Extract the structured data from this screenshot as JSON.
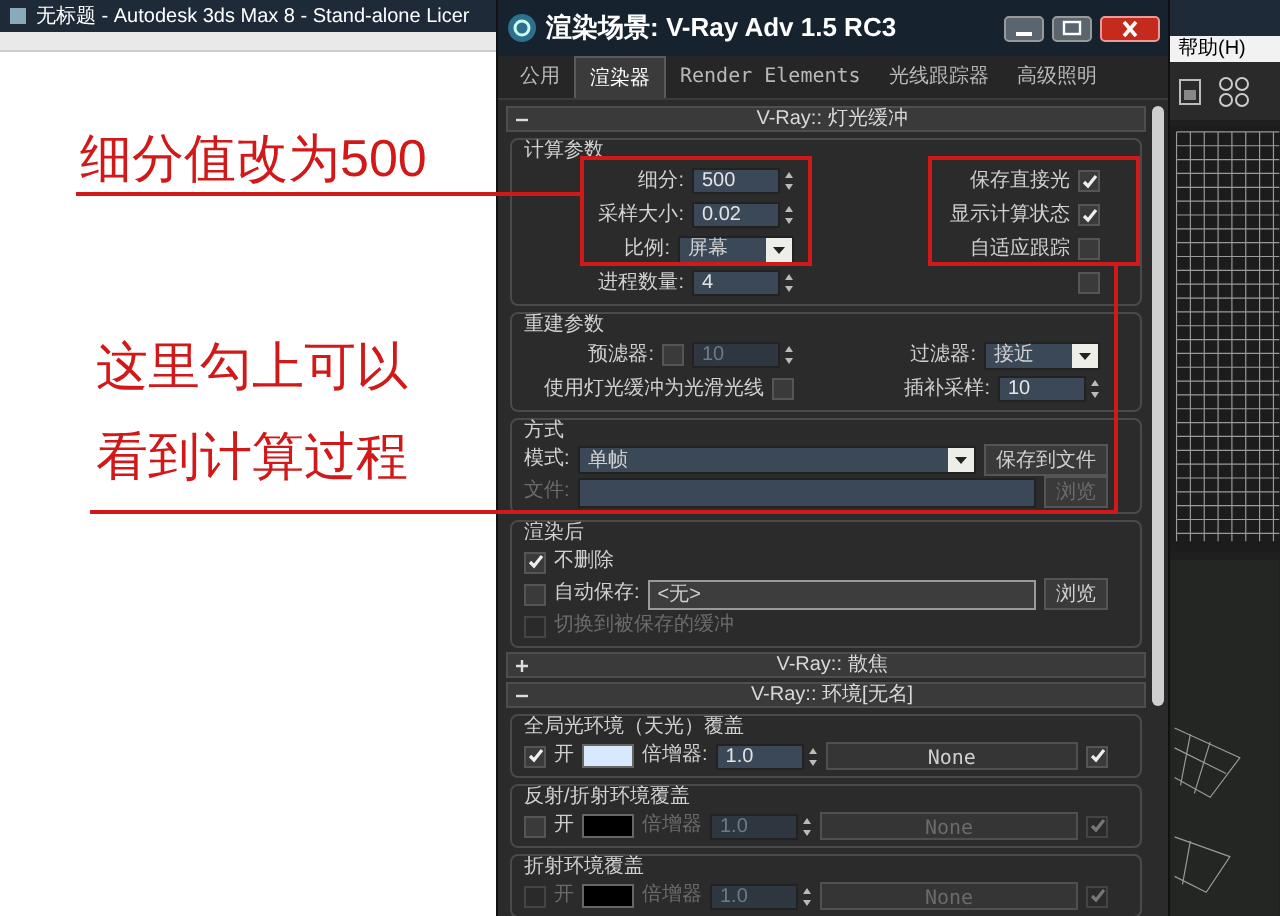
{
  "background_window": {
    "title": "无标题 - Autodesk 3ds Max 8 - Stand-alone Licer",
    "help_menu": "帮助(H)"
  },
  "dialog": {
    "title": "渲染场景: V-Ray Adv 1.5 RC3",
    "tabs": [
      {
        "label": "公用",
        "selected": false
      },
      {
        "label": "渲染器",
        "selected": true
      },
      {
        "label": "Render Elements",
        "selected": false
      },
      {
        "label": "光线跟踪器",
        "selected": false
      },
      {
        "label": "高级照明",
        "selected": false
      }
    ],
    "rollouts": [
      {
        "title": "V-Ray:: 灯光缓冲",
        "expanded": true,
        "groups": [
          {
            "title": "计算参数",
            "rows": [
              {
                "kind": "split",
                "left": [
                  {
                    "kind": "text",
                    "text": "细分:",
                    "disabled": false
                  },
                  {
                    "kind": "spinner",
                    "value": "500",
                    "disabled": false
                  }
                ],
                "right": [
                  {
                    "kind": "text",
                    "text": "保存直接光",
                    "disabled": false
                  },
                  {
                    "kind": "checkbox",
                    "checked": true,
                    "disabled": false
                  }
                ]
              },
              {
                "kind": "split",
                "left": [
                  {
                    "kind": "text",
                    "text": "采样大小:",
                    "disabled": false
                  },
                  {
                    "kind": "spinner",
                    "value": "0.02",
                    "disabled": false
                  }
                ],
                "right": [
                  {
                    "kind": "text",
                    "text": "显示计算状态",
                    "disabled": false
                  },
                  {
                    "kind": "checkbox",
                    "checked": true,
                    "disabled": false
                  }
                ]
              },
              {
                "kind": "split",
                "left": [
                  {
                    "kind": "text",
                    "text": "比例:",
                    "disabled": false
                  },
                  {
                    "kind": "dropdown",
                    "value": "屏幕",
                    "disabled": false
                  }
                ],
                "right": [
                  {
                    "kind": "text",
                    "text": "自适应跟踪",
                    "disabled": false
                  },
                  {
                    "kind": "checkbox",
                    "checked": false,
                    "disabled": false
                  }
                ]
              },
              {
                "kind": "split",
                "left": [
                  {
                    "kind": "text",
                    "text": "进程数量:",
                    "disabled": false
                  },
                  {
                    "kind": "spinner",
                    "value": "4",
                    "disabled": false
                  }
                ],
                "right": [
                  {
                    "kind": "checkbox",
                    "checked": false,
                    "disabled": false
                  }
                ]
              }
            ]
          },
          {
            "title": "重建参数",
            "rows": [
              {
                "kind": "split",
                "left": [
                  {
                    "kind": "text",
                    "text": "预滤器:",
                    "disabled": false
                  },
                  {
                    "kind": "checkbox",
                    "checked": false,
                    "disabled": false
                  },
                  {
                    "kind": "spinner",
                    "value": "10",
                    "disabled": true
                  }
                ],
                "right": [
                  {
                    "kind": "text",
                    "text": "过滤器:",
                    "disabled": false
                  },
                  {
                    "kind": "dropdown",
                    "value": "接近",
                    "disabled": false
                  }
                ]
              },
              {
                "kind": "split",
                "left": [
                  {
                    "kind": "text",
                    "text": "使用灯光缓冲为光滑光线",
                    "disabled": false
                  },
                  {
                    "kind": "checkbox",
                    "checked": false,
                    "disabled": false
                  }
                ],
                "right": [
                  {
                    "kind": "text",
                    "text": "插补采样:",
                    "disabled": false
                  },
                  {
                    "kind": "spinner",
                    "value": "10",
                    "disabled": false
                  }
                ]
              }
            ]
          },
          {
            "title": "方式",
            "rows": [
              {
                "kind": "fill",
                "items": [
                  {
                    "kind": "text",
                    "text": "模式:",
                    "disabled": false
                  },
                  {
                    "kind": "dropdown",
                    "value": "单帧",
                    "disabled": false
                  },
                  {
                    "kind": "button",
                    "label": "保存到文件",
                    "disabled": false
                  }
                ]
              },
              {
                "kind": "fill",
                "items": [
                  {
                    "kind": "text",
                    "text": "文件:",
                    "disabled": true
                  },
                  {
                    "kind": "field",
                    "value": "",
                    "disabled": false
                  },
                  {
                    "kind": "button",
                    "label": "浏览",
                    "disabled": true
                  }
                ]
              }
            ]
          },
          {
            "title": "渲染后",
            "rows": [
              {
                "kind": "fill",
                "items": [
                  {
                    "kind": "checkbox",
                    "checked": true,
                    "disabled": false
                  },
                  {
                    "kind": "text",
                    "text": "不删除",
                    "disabled": false
                  }
                ]
              },
              {
                "kind": "fill",
                "items": [
                  {
                    "kind": "checkbox",
                    "checked": false,
                    "disabled": false
                  },
                  {
                    "kind": "text",
                    "text": "自动保存:",
                    "disabled": false
                  },
                  {
                    "kind": "field",
                    "value": "<无>",
                    "disabled": false
                  },
                  {
                    "kind": "button",
                    "label": "浏览",
                    "disabled": false
                  }
                ]
              },
              {
                "kind": "fill",
                "items": [
                  {
                    "kind": "checkbox",
                    "checked": false,
                    "disabled": true
                  },
                  {
                    "kind": "text",
                    "text": "切换到被保存的缓冲",
                    "disabled": true
                  }
                ]
              }
            ]
          }
        ]
      },
      {
        "title": "V-Ray:: 散焦",
        "expanded": false
      },
      {
        "title": "V-Ray:: 环境[无名]",
        "expanded": true,
        "groups": [
          {
            "title": "全局光环境（天光）覆盖",
            "rows": [
              {
                "kind": "fill",
                "items": [
                  {
                    "kind": "checkbox",
                    "checked": true,
                    "disabled": false
                  },
                  {
                    "kind": "text",
                    "text": "开",
                    "disabled": false
                  },
                  {
                    "kind": "swatch",
                    "color": "#d8e8ff"
                  },
                  {
                    "kind": "text",
                    "text": "倍增器:",
                    "disabled": false
                  },
                  {
                    "kind": "spinner",
                    "value": "1.0",
                    "disabled": false
                  },
                  {
                    "kind": "map_button",
                    "label": "None",
                    "disabled": false
                  },
                  {
                    "kind": "checkbox",
                    "checked": true,
                    "disabled": false
                  }
                ]
              }
            ]
          },
          {
            "title": "反射/折射环境覆盖",
            "rows": [
              {
                "kind": "fill",
                "items": [
                  {
                    "kind": "checkbox",
                    "checked": false,
                    "disabled": false
                  },
                  {
                    "kind": "text",
                    "text": "开",
                    "disabled": false
                  },
                  {
                    "kind": "swatch",
                    "color": "#000000"
                  },
                  {
                    "kind": "text",
                    "text": "倍增器",
                    "disabled": true
                  },
                  {
                    "kind": "spinner",
                    "value": "1.0",
                    "disabled": true
                  },
                  {
                    "kind": "map_button",
                    "label": "None",
                    "disabled": true
                  },
                  {
                    "kind": "checkbox",
                    "checked": true,
                    "disabled": true
                  }
                ]
              }
            ]
          },
          {
            "title": "折射环境覆盖",
            "rows": [
              {
                "kind": "fill",
                "items": [
                  {
                    "kind": "checkbox",
                    "checked": false,
                    "disabled": true
                  },
                  {
                    "kind": "text",
                    "text": "开",
                    "disabled": true
                  },
                  {
                    "kind": "swatch",
                    "color": "#000000"
                  },
                  {
                    "kind": "text",
                    "text": "倍增器",
                    "disabled": true
                  },
                  {
                    "kind": "spinner",
                    "value": "1.0",
                    "disabled": true
                  },
                  {
                    "kind": "map_button",
                    "label": "None",
                    "disabled": true
                  },
                  {
                    "kind": "checkbox",
                    "checked": true,
                    "disabled": true
                  }
                ]
              }
            ]
          }
        ]
      }
    ]
  },
  "annotations": [
    {
      "text": "细分值改为500"
    },
    {
      "text": "这里勾上可以"
    },
    {
      "text": "看到计算过程"
    }
  ]
}
